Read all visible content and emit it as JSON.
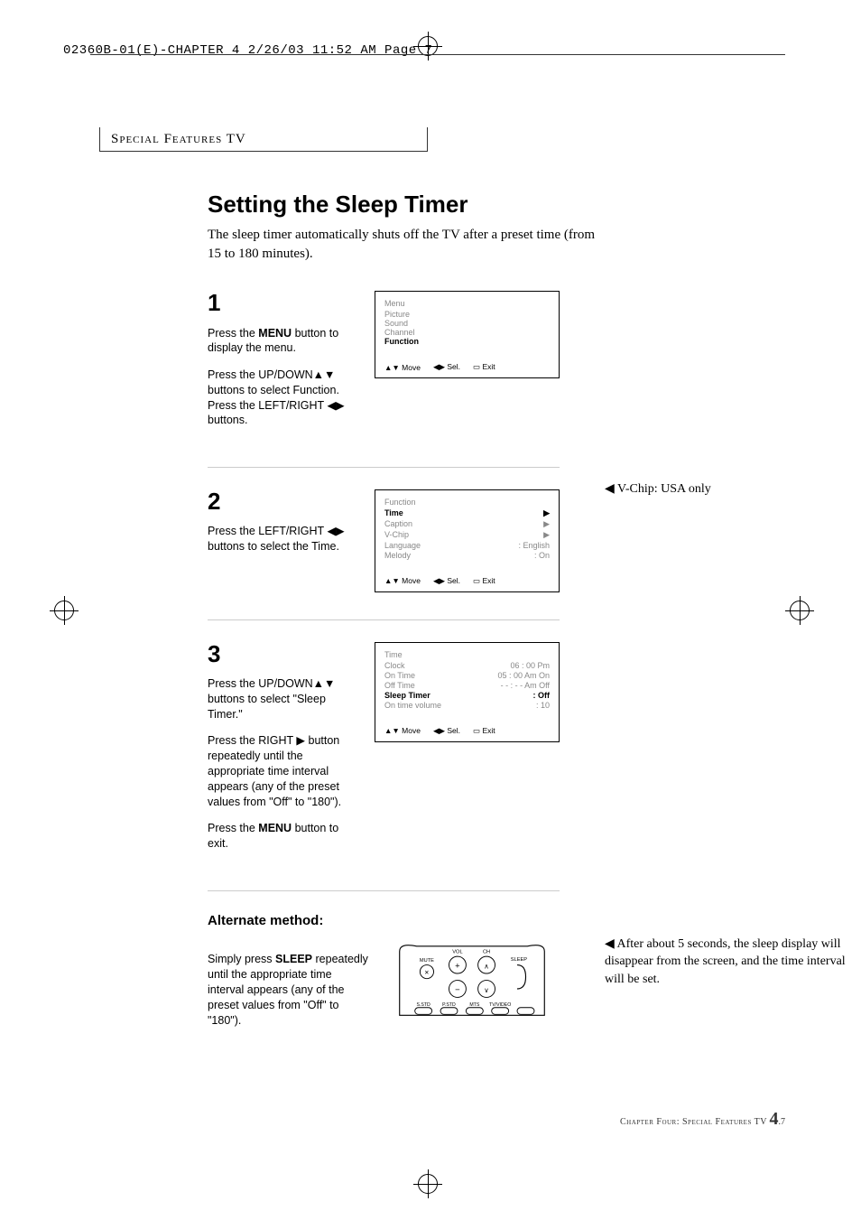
{
  "print_header": "02360B-01(E)-CHAPTER 4  2/26/03  11:52 AM  Page 7",
  "section_header": "Special Features TV",
  "title": "Setting the Sleep Timer",
  "intro": "The sleep timer automatically shuts off the TV after a preset time (from 15 to 180 minutes).",
  "steps": {
    "s1": {
      "num": "1",
      "p1a": "Press the ",
      "p1b": "MENU",
      "p1c": " button to display the menu.",
      "p2": "Press the UP/DOWN▲▼ buttons to select Function. Press the LEFT/RIGHT ◀▶ buttons.",
      "osd_title": "Menu",
      "items": [
        "Picture",
        "Sound",
        "Channel"
      ],
      "hl": "Function"
    },
    "s2": {
      "num": "2",
      "p1": "Press the LEFT/RIGHT ◀▶ buttons to select the Time.",
      "osd_title": "Function",
      "rows": [
        {
          "l": "Time",
          "r": "▶",
          "hl": true
        },
        {
          "l": "Caption",
          "r": "▶"
        },
        {
          "l": "V-Chip",
          "r": "▶"
        },
        {
          "l": "Language",
          "r": ": English"
        },
        {
          "l": "Melody",
          "r": ": On"
        }
      ],
      "side_note": "V-Chip: USA only"
    },
    "s3": {
      "num": "3",
      "p1": "Press the UP/DOWN▲▼ buttons to select \"Sleep Timer.\"",
      "p2": "Press the RIGHT ▶ button repeatedly until the appropriate time interval appears (any of the preset values from \"Off\" to \"180\").",
      "p3a": "Press the ",
      "p3b": "MENU",
      "p3c": " button to exit.",
      "osd_title": "Time",
      "rows": [
        {
          "l": "Clock",
          "r": "06 : 00 Pm"
        },
        {
          "l": "On Time",
          "r": "05 : 00 Am  On"
        },
        {
          "l": "Off Time",
          "r": "- - : - - Am  Off"
        },
        {
          "l": "Sleep Timer",
          "r": ":   Off",
          "hl": true
        },
        {
          "l": "On time volume",
          "r": ":         10"
        }
      ]
    }
  },
  "osd_footer": {
    "move": "Move",
    "sel": "Sel.",
    "exit": "Exit"
  },
  "alt": {
    "heading": "Alternate method:",
    "p1a": "Simply press ",
    "p1b": "SLEEP",
    "p1c": " repeatedly until the appropriate time interval appears (any of the preset values from \"Off\" to \"180\").",
    "side_note": "After about 5 seconds, the sleep display will disappear from the screen, and the time interval will be set."
  },
  "remote_labels": {
    "vol": "VOL",
    "ch": "CH",
    "mute": "MUTE",
    "sleep": "SLEEP",
    "sstd": "S.STD",
    "pstd": "P.STD",
    "mts": "MTS",
    "tvvideo": "TV/VIDEO"
  },
  "footer": {
    "chap_text": "Chapter Four: Special Features TV",
    "chap_num": "4",
    "page_num": ".7"
  }
}
